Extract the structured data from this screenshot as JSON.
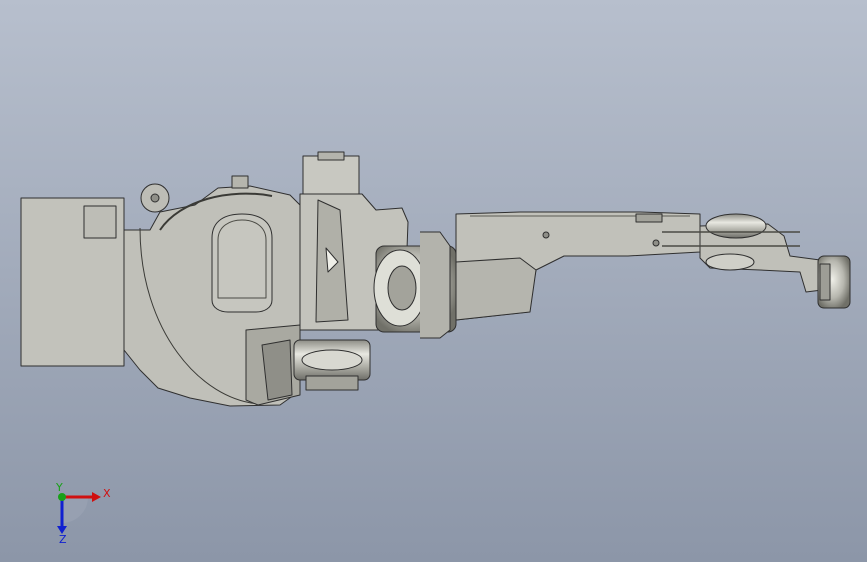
{
  "viewport": {
    "background_top": "#b7bfcd",
    "background_bottom": "#8c96a8"
  },
  "model": {
    "body_color": "#bfbfb8",
    "edge_color": "#2f2f2f",
    "shadow_color": "#8f8f88",
    "highlight_color": "#e6e6df",
    "metal_color": "#9d9d96"
  },
  "triad": {
    "x_label": "X",
    "y_label": "Y",
    "z_label": "Z",
    "x_color": "#d01010",
    "y_color": "#18a018",
    "z_color": "#1020d0"
  }
}
